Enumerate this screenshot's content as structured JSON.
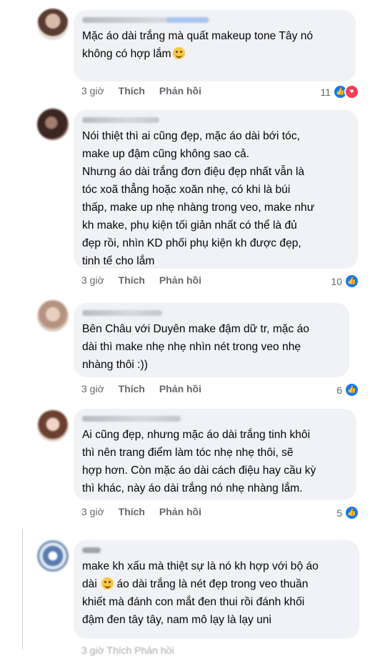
{
  "comments": [
    {
      "text": "Mặc áo dài trắng mà quất makeup tone Tây nó\nkhông có hợp lắm",
      "emoji": "grinning-sweat-emoji",
      "time": "3 giờ",
      "like": "Thích",
      "reply": "Phản hồi",
      "reactions": "11",
      "reaction_icons": [
        "like-icon",
        "love-icon"
      ]
    },
    {
      "text": "Nói thiệt thì ai cũng đẹp, mặc áo dài bới tóc,\nmake up đậm cũng không sao cả.\nNhưng áo dài trắng đơn điệu đẹp nhất vẫn là\ntóc xoã thẳng hoặc xoăn nhẹ, có khi là búi\nthấp, make up nhẹ nhàng trong veo, make như\nkh make, phụ kiện tối giản nhất có thể là đủ\nđẹp rồi, nhìn KD phối phụ kiện kh được đẹp,\ntinh tế cho lắm",
      "time": "3 giờ",
      "like": "Thích",
      "reply": "Phản hồi",
      "reactions": "10",
      "reaction_icons": [
        "like-icon"
      ]
    },
    {
      "text": "Bên Châu với Duyên make đậm dữ tr, mặc áo\ndài thì make nhẹ nhẹ nhìn nét trong veo nhẹ\nnhàng thôi :))",
      "time": "3 giờ",
      "like": "Thích",
      "reply": "Phản hồi",
      "reactions": "6",
      "reaction_icons": [
        "like-icon"
      ]
    },
    {
      "text": "Ai cũng đẹp, nhưng mặc áo dài trắng tinh khôi\nthì nên trang điểm làm tóc nhẹ nhẹ thôi, sẽ\nhợp hơn. Còn mặc áo dài cách điệu hay cầu kỳ\nthì khác, này áo dài trắng nó nhẹ nhàng lắm.",
      "time": "3 giờ",
      "like": "Thích",
      "reply": "Phản hồi",
      "reactions": "5",
      "reaction_icons": [
        "like-icon"
      ]
    },
    {
      "text_a": "make kh xấu mà thiệt sự là nó kh hợp với bộ áo",
      "text_b": "dài",
      "text_c": " áo dài trắng là nét đẹp trong veo thuần\nkhiết mà đánh con mắt đen thui rồi đánh khối\nđậm đen tây tây, nam mô lạy là lạy uni",
      "emoji": "smiling-emoji",
      "cut_text": "3 giờ   Thích   Phản hồi"
    }
  ],
  "colors": {
    "bubble": "#f0f2f5",
    "meta": "#65676b",
    "like_blue": "#1877f2",
    "love_red": "#f33e58"
  }
}
